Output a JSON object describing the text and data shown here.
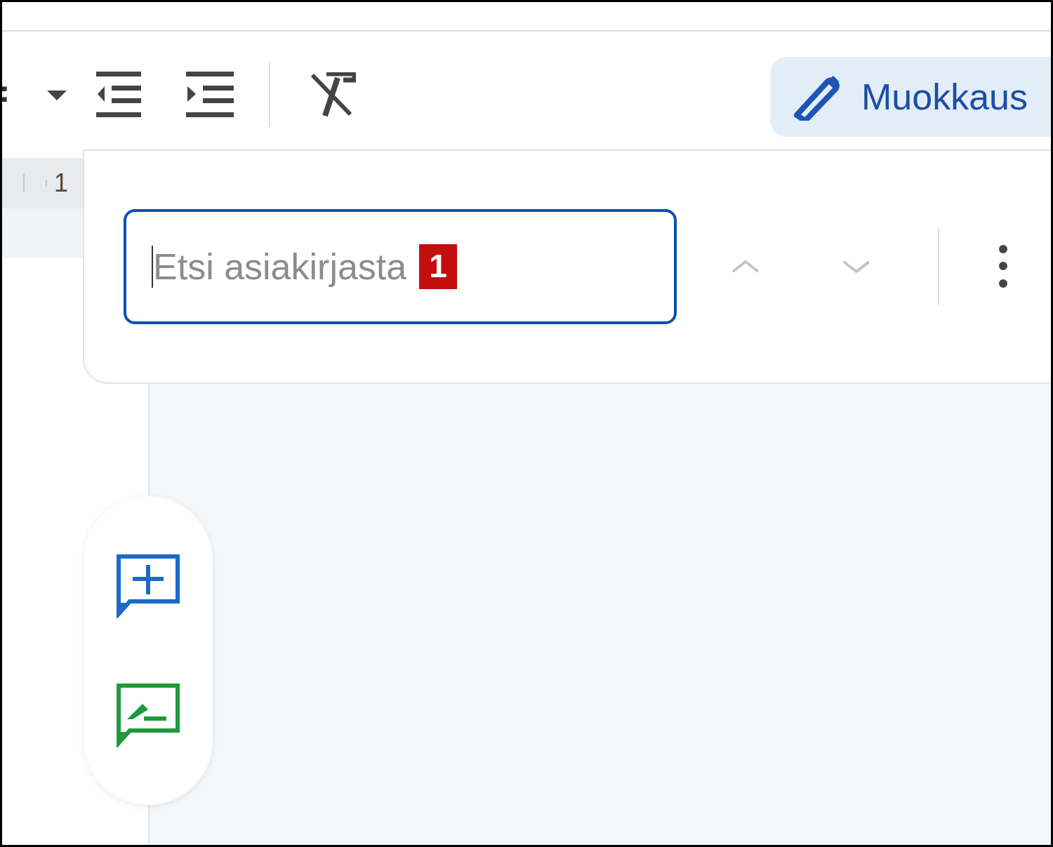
{
  "toolbar": {
    "mode_button": {
      "label": "Muokkaus"
    }
  },
  "ruler": {
    "label": "1"
  },
  "find_bar": {
    "field": {
      "placeholder": "Etsi asiakirjasta",
      "badge": "1"
    },
    "previous": {
      "disabled": true
    },
    "next": {
      "disabled": true
    }
  }
}
